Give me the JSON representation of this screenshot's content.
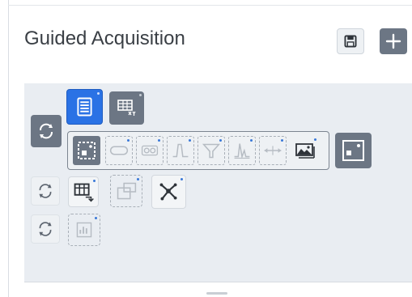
{
  "panel": {
    "title": "Guided Acquisition"
  },
  "header": {
    "save_icon": "floppy-disk-icon",
    "add_icon": "plus-icon"
  },
  "colors": {
    "accent": "#2a72e5",
    "button_grey": "#6c7684",
    "canvas_bg": "#e9edf2",
    "badge": "#3a78d8"
  },
  "workflow": {
    "rows": [
      {
        "icons": [
          "refresh-icon",
          "document-list-icon",
          "grid-xy-icon"
        ]
      },
      {
        "icons": [
          "refresh-icon",
          "image-target-icon",
          "pill-icon",
          "link-icon",
          "waveform-icon",
          "filter-icon",
          "peak-icon",
          "axis-arrows-icon",
          "picture-icon",
          "image-target-icon"
        ]
      },
      {
        "icons": [
          "refresh-icon",
          "grid-transfer-icon",
          "overlay-squares-icon",
          "network-node-icon"
        ]
      },
      {
        "icons": [
          "refresh-icon",
          "bar-chart-icon"
        ]
      }
    ]
  }
}
